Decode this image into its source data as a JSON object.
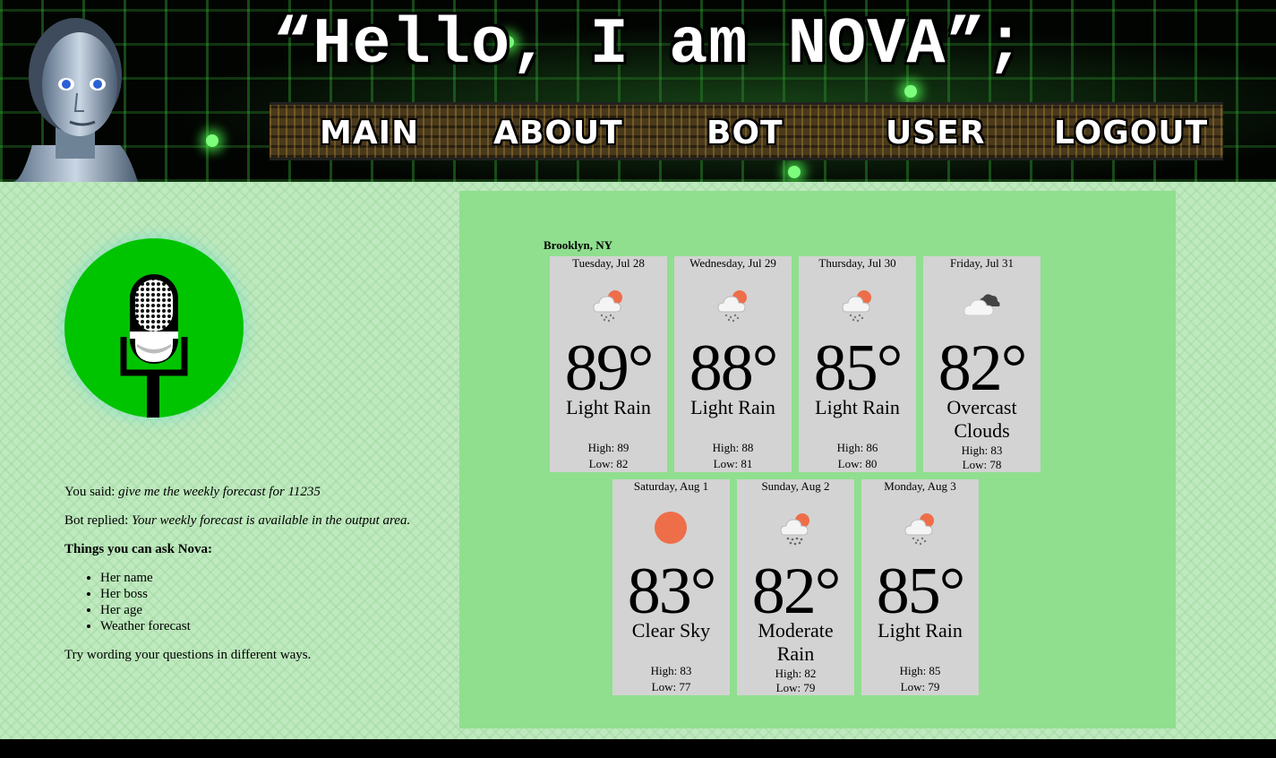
{
  "header": {
    "title": "“Hello, I am NOVA”;",
    "nav": [
      {
        "label": "MAIN"
      },
      {
        "label": "ABOUT"
      },
      {
        "label": "BOT"
      },
      {
        "label": "USER"
      },
      {
        "label": "LOGOUT"
      }
    ]
  },
  "conversation": {
    "you_said_label": "You said:",
    "you_said_text": "give me the weekly forecast for 11235",
    "bot_replied_label": "Bot replied:",
    "bot_replied_text": "Your weekly forecast is available in the output area.",
    "tips_heading": "Things you can ask Nova:",
    "tips": [
      "Her name",
      "Her boss",
      "Her age",
      "Weather forecast"
    ],
    "footer_note": "Try wording your questions in different ways."
  },
  "weather": {
    "location": "Brooklyn, NY",
    "days": [
      {
        "day": "Tuesday, Jul 28",
        "icon": "light-rain-icon",
        "temp": "89°",
        "condition": "Light Rain",
        "high": "High: 89",
        "low": "Low: 82"
      },
      {
        "day": "Wednesday, Jul 29",
        "icon": "light-rain-icon",
        "temp": "88°",
        "condition": "Light Rain",
        "high": "High: 88",
        "low": "Low: 81"
      },
      {
        "day": "Thursday, Jul 30",
        "icon": "light-rain-icon",
        "temp": "85°",
        "condition": "Light Rain",
        "high": "High: 86",
        "low": "Low: 80"
      },
      {
        "day": "Friday, Jul 31",
        "icon": "overcast-clouds-icon",
        "temp": "82°",
        "condition": "Overcast Clouds",
        "high": "High: 83",
        "low": "Low: 78"
      },
      {
        "day": "Saturday, Aug 1",
        "icon": "sun-icon",
        "temp": "83°",
        "condition": "Clear Sky",
        "high": "High: 83",
        "low": "Low: 77"
      },
      {
        "day": "Sunday, Aug 2",
        "icon": "moderate-rain-icon",
        "temp": "82°",
        "condition": "Moderate Rain",
        "high": "High: 82",
        "low": "Low: 79"
      },
      {
        "day": "Monday, Aug 3",
        "icon": "light-rain-icon",
        "temp": "85°",
        "condition": "Light Rain",
        "high": "High: 85",
        "low": "Low: 79"
      }
    ]
  },
  "colors": {
    "mic_button": "#00c400",
    "panel": "#8fdf8f",
    "card": "#d3d3d3",
    "sun": "#ee6e4a"
  }
}
